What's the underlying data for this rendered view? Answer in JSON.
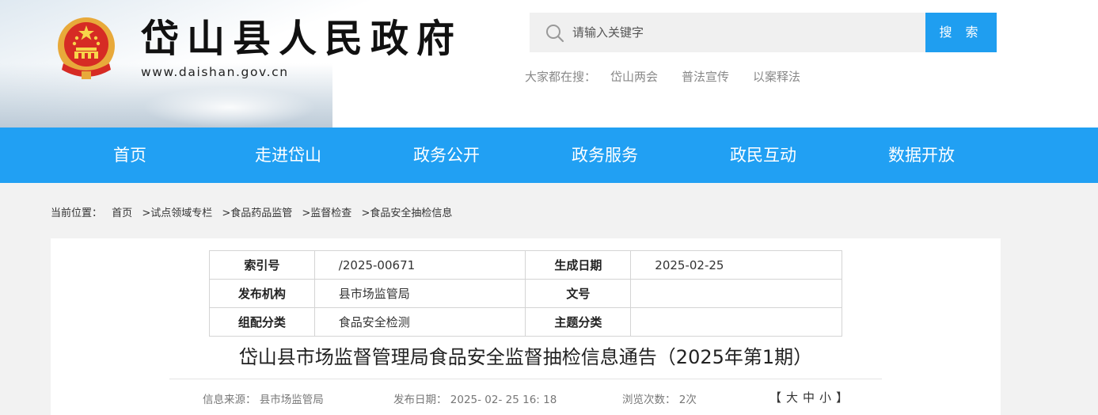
{
  "header": {
    "site_title": "岱山县人民政府",
    "site_url": "www.daishan.gov.cn",
    "search": {
      "placeholder": "请输入关键字",
      "button_label": "搜 索"
    },
    "hot_search": {
      "label": "大家都在搜：",
      "items": [
        "岱山两会",
        "普法宣传",
        "以案释法"
      ]
    }
  },
  "nav": {
    "items": [
      "首页",
      "走进岱山",
      "政务公开",
      "政务服务",
      "政民互动",
      "数据开放"
    ],
    "background": "#21a0f3"
  },
  "breadcrumb": {
    "label": "当前位置：",
    "items": [
      "首页",
      ">试点领域专栏",
      ">食品药品监管",
      ">监督检查",
      ">食品安全抽检信息"
    ]
  },
  "meta_table": {
    "rows": [
      {
        "k1": "索引号",
        "v1": "/2025-00671",
        "k2": "生成日期",
        "v2": "2025-02-25"
      },
      {
        "k1": "发布机构",
        "v1": "县市场监管局",
        "k2": "文号",
        "v2": ""
      },
      {
        "k1": "组配分类",
        "v1": "食品安全检测",
        "k2": "主题分类",
        "v2": ""
      }
    ]
  },
  "article": {
    "title": "岱山县市场监督管理局食品安全监督抽检信息通告（2025年第1期）",
    "source": "信息来源： 县市场监管局",
    "publish_date": "发布日期： 2025- 02- 25 16: 18",
    "views": "浏览次数： 2次",
    "font_size": {
      "open": "【",
      "large": "大",
      "medium": "中",
      "small": "小",
      "close": "】"
    }
  }
}
